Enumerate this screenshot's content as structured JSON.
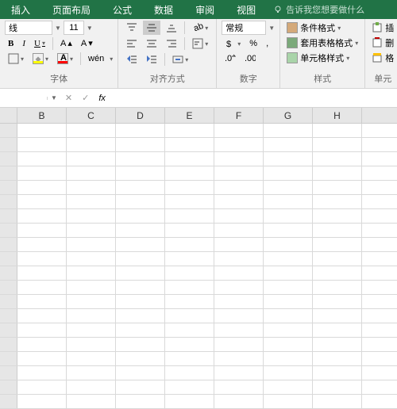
{
  "tabs": {
    "insert": "插入",
    "layout": "页面布局",
    "formula": "公式",
    "data": "数据",
    "review": "审阅",
    "view": "视图"
  },
  "tellme": "告诉我您想要做什么",
  "font": {
    "name": "线",
    "size": "11",
    "groupLabel": "字体",
    "wen": "wén"
  },
  "align": {
    "groupLabel": "对齐方式"
  },
  "number": {
    "format": "常规",
    "groupLabel": "数字",
    "percent": "%"
  },
  "styles": {
    "cond": "条件格式",
    "table": "套用表格格式",
    "cell": "单元格样式",
    "groupLabel": "样式"
  },
  "cells": {
    "insert": "插",
    "delete": "删",
    "format": "格",
    "groupLabel": "单元"
  },
  "cols": [
    "",
    "B",
    "C",
    "D",
    "E",
    "F",
    "G",
    "H"
  ]
}
